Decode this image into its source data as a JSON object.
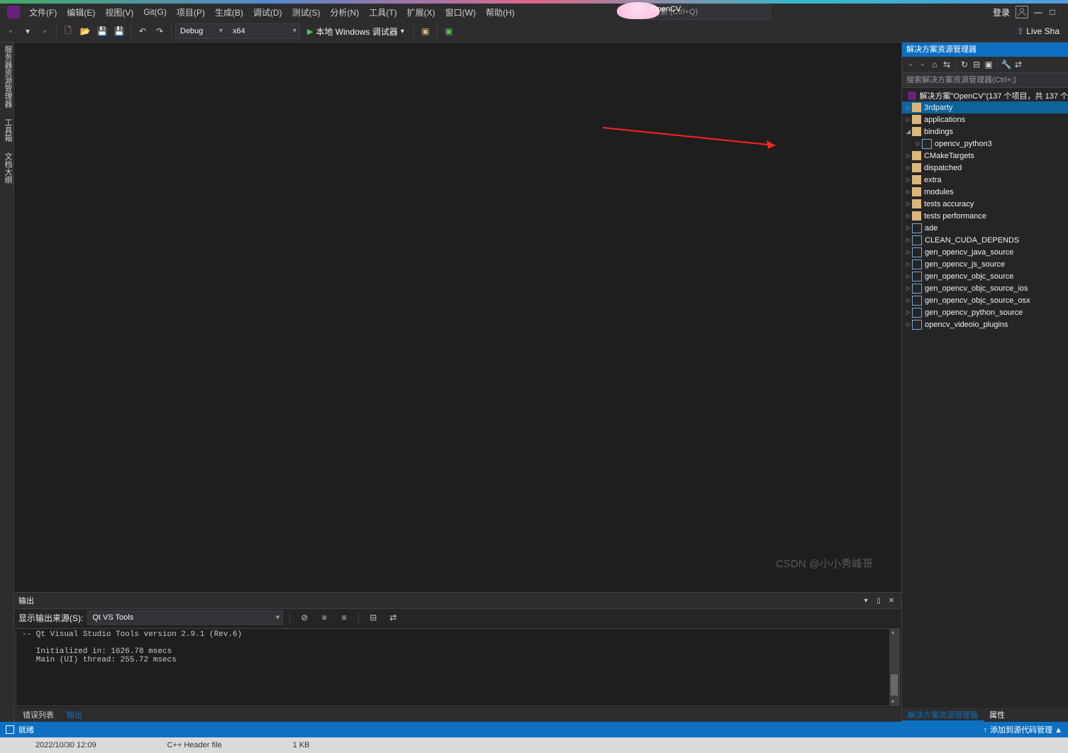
{
  "menu": {
    "file": "文件(F)",
    "edit": "编辑(E)",
    "view": "视图(V)",
    "git": "Git(G)",
    "project": "项目(P)",
    "build": "生成(B)",
    "debug": "调试(D)",
    "test": "测试(S)",
    "analyze": "分析(N)",
    "tools": "工具(T)",
    "extensions": "扩展(X)",
    "window": "窗口(W)",
    "help": "帮助(H)"
  },
  "search_placeholder": "搜索 (Ctrl+Q)",
  "project_label": "OpenCV",
  "login": "登录",
  "toolbar": {
    "config": "Debug",
    "platform": "x64",
    "run": "本地 Windows 调试器",
    "live_share": "Live Sha"
  },
  "left_rails": [
    "服务器资源管理器",
    "工具箱",
    "文档大纲"
  ],
  "output": {
    "title": "输出",
    "source_label": "显示输出来源(S):",
    "source_value": "Qt VS Tools",
    "body": "-- Qt Visual Studio Tools version 2.9.1 (Rev.6)\n\n   Initialized in: 1626.78 msecs\n   Main (UI) thread: 255.72 msecs"
  },
  "bottom_tabs": {
    "errorlist": "错误列表",
    "output": "输出"
  },
  "solution_panel": {
    "title": "解决方案资源管理器",
    "search_placeholder": "搜索解决方案资源管理器(Ctrl+;)",
    "solution": "解决方案\"OpenCV\"(137 个项目，共 137 个",
    "items": [
      {
        "t": "f",
        "l": "3rdparty",
        "sel": true,
        "d": 1
      },
      {
        "t": "f",
        "l": "applications",
        "d": 1
      },
      {
        "t": "f",
        "l": "bindings",
        "d": 1,
        "open": true
      },
      {
        "t": "p",
        "l": "opencv_python3",
        "d": 2
      },
      {
        "t": "f",
        "l": "CMakeTargets",
        "d": 1
      },
      {
        "t": "f",
        "l": "dispatched",
        "d": 1
      },
      {
        "t": "f",
        "l": "extra",
        "d": 1
      },
      {
        "t": "f",
        "l": "modules",
        "d": 1
      },
      {
        "t": "f",
        "l": "tests accuracy",
        "d": 1
      },
      {
        "t": "f",
        "l": "tests performance",
        "d": 1
      },
      {
        "t": "p",
        "l": "ade",
        "d": 1
      },
      {
        "t": "p",
        "l": "CLEAN_CUDA_DEPENDS",
        "d": 1
      },
      {
        "t": "p",
        "l": "gen_opencv_java_source",
        "d": 1
      },
      {
        "t": "p",
        "l": "gen_opencv_js_source",
        "d": 1
      },
      {
        "t": "p",
        "l": "gen_opencv_objc_source",
        "d": 1
      },
      {
        "t": "p",
        "l": "gen_opencv_objc_source_ios",
        "d": 1
      },
      {
        "t": "p",
        "l": "gen_opencv_objc_source_osx",
        "d": 1
      },
      {
        "t": "p",
        "l": "gen_opencv_python_source",
        "d": 1
      },
      {
        "t": "p",
        "l": "opencv_videoio_plugins",
        "d": 1
      }
    ],
    "bottom_tabs": {
      "explorer": "解决方案资源管理器",
      "properties": "属性"
    }
  },
  "statusbar": {
    "ready": "就绪",
    "source_control": "添加到源代码管理 ▲"
  },
  "taskbar": {
    "date": "2022/10/30 12:09",
    "filetype": "C++ Header file",
    "size": "1 KB"
  },
  "watermark": "CSDN @小小秀峰哥"
}
